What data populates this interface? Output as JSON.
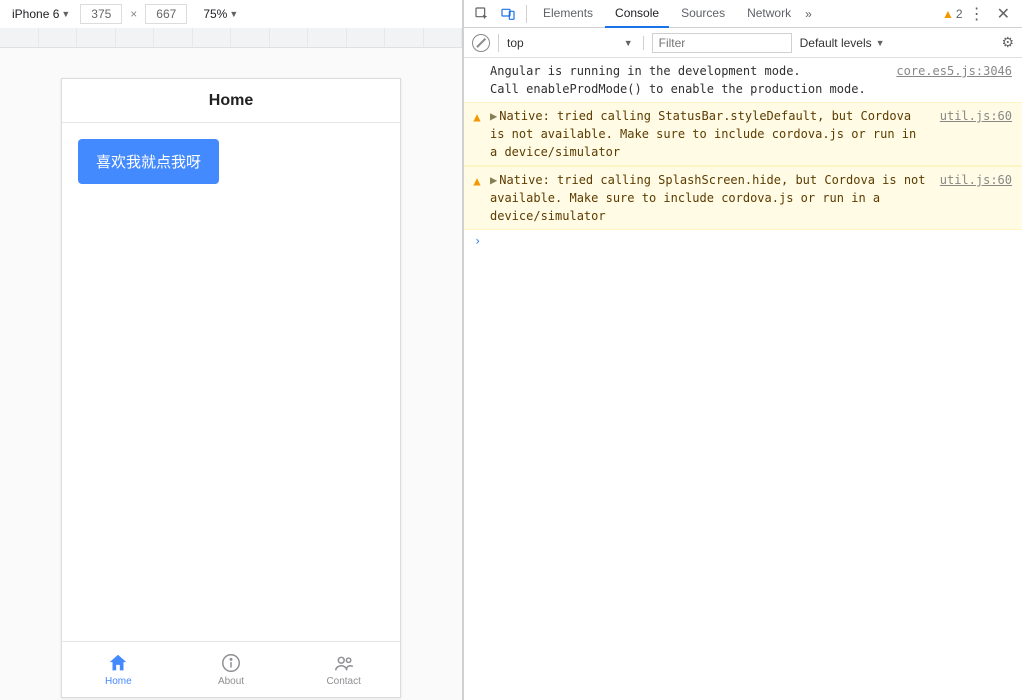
{
  "device_toolbar": {
    "device": "iPhone 6",
    "width": "375",
    "height": "667",
    "zoom": "75%"
  },
  "app": {
    "header_title": "Home",
    "button_label": "喜欢我就点我呀",
    "tabs": [
      {
        "label": "Home"
      },
      {
        "label": "About"
      },
      {
        "label": "Contact"
      }
    ]
  },
  "devtools": {
    "tabs": {
      "elements": "Elements",
      "console": "Console",
      "sources": "Sources",
      "network": "Network"
    },
    "warning_count": "2",
    "context": "top",
    "filter_placeholder": "Filter",
    "level_label": "Default levels"
  },
  "console": {
    "logs": [
      {
        "type": "info",
        "text": "Angular is running in the development mode.\nCall enableProdMode() to enable the production mode.",
        "source": "core.es5.js:3046"
      },
      {
        "type": "warn",
        "text": "Native: tried calling StatusBar.styleDefault, but Cordova is not available. Make sure to include cordova.js or run in a device/simulator",
        "source": "util.js:60"
      },
      {
        "type": "warn",
        "text": "Native: tried calling SplashScreen.hide, but Cordova is not available. Make sure to include cordova.js or run in a device/simulator",
        "source": "util.js:60"
      }
    ],
    "prompt": "›"
  }
}
